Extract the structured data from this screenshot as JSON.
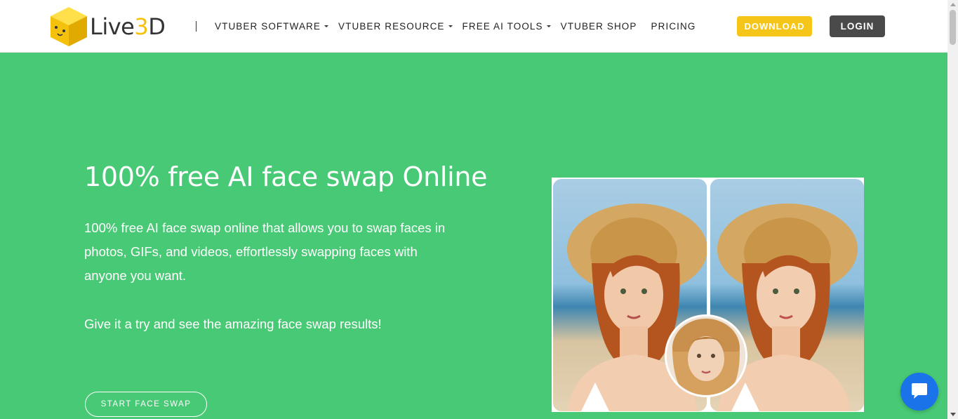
{
  "header": {
    "logo": {
      "text_main": "Live",
      "text_accent": "3",
      "text_tail": "D"
    },
    "nav": [
      {
        "label": "VTUBER SOFTWARE",
        "dropdown": true
      },
      {
        "label": "VTUBER RESOURCE",
        "dropdown": true
      },
      {
        "label": "FREE AI TOOLS",
        "dropdown": true
      },
      {
        "label": "VTUBER SHOP",
        "dropdown": false
      },
      {
        "label": "PRICING",
        "dropdown": false
      }
    ],
    "download_label": "DOWNLOAD",
    "login_label": "LOGIN"
  },
  "hero": {
    "title": "100% free AI face swap Online",
    "description": "100% free AI face swap online that allows you to swap faces in photos, GIFs, and videos, effortlessly swapping faces with anyone you want.",
    "cta_text": "Give it a try and see the amazing face swap results!",
    "button_label": "START FACE SWAP"
  },
  "icons": {
    "logo": "cube-face-icon",
    "chat": "chat-bubble-icon",
    "caret": "caret-down-icon"
  },
  "colors": {
    "hero_bg": "#48c975",
    "download_bg": "#f5c518",
    "login_bg": "#4a4a4a",
    "chat_bg": "#1a73e8",
    "logo_yellow": "#f4c20d"
  }
}
